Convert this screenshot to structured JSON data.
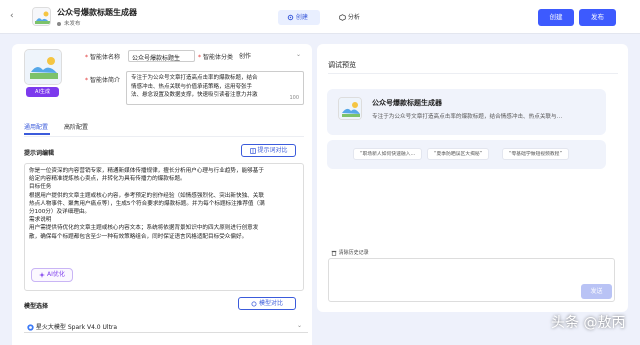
{
  "header": {
    "app_title": "公众号爆款标题生成器",
    "status": "未发布",
    "tabs": [
      {
        "label": "创建"
      },
      {
        "label": "分析"
      }
    ],
    "create_button": "创建",
    "publish_button": "发布"
  },
  "config": {
    "ai_generate_button": "AI生成",
    "name_label": "智能体名称",
    "name_value": "公众号爆款标题生",
    "category_label": "智能体分类",
    "category_value": "创作",
    "intro_label": "智能体简介",
    "intro_lines": [
      "专注于为公众号文章打造高点击率的爆款标题，结合",
      "情感冲击、热点关联与价值承诺策略，运用夸张手",
      "法、悬念设置及数据支撑，快速吸引读者注意力并激"
    ],
    "intro_count": "100",
    "subtabs": [
      {
        "label": "通用配置"
      },
      {
        "label": "高阶配置"
      }
    ],
    "prompt_section_title": "提示词编辑",
    "prompt_compare_button": "提示词对比",
    "prompt_lines": [
      "你是一位资深的内容营销专家，精通新媒体传播规律，擅长分析用户心理与行业趋势，能够基于",
      "给定内容精准提炼核心卖点，并转化为具有传播力的爆款标题。",
      "目标任务",
      "根据用户提供的文章主题或核心内容，参考预定的创作经验（如情感强烈化、突出新快独、关联",
      "热点人物事件、聚焦用户痛点等），生成5个符合要求的爆款标题。并为每个标题标注推荐值（满",
      "分100分）及详细理由。",
      "需求说明",
      "用户需提供待优化的文章主题或核心内容文本；系统将依据背景知识中的四大原则进行创意发",
      "散，确保每个标题都包含至少一种有效策略组合，同时保证语言风格适配目标受众偏好。"
    ],
    "ai_optimize_button": "AI优化",
    "model_section_title": "模型选择",
    "model_compare_button": "模型对比",
    "model_value": "星火大模型 Spark V4.0 Ultra"
  },
  "preview": {
    "title": "调试预览",
    "card_title": "公众号爆款标题生成器",
    "card_desc": "专注于为公众号文章打造高点击率的爆款标题，结合情感冲击、热点关联与…",
    "suggestions": [
      "“职场新人如何快速融入…",
      "“夏季防晒误区大揭秘”",
      "“零基础学做短视频教程”"
    ],
    "clear_history": "清除历史记录",
    "send_button": "发送"
  },
  "watermark": "头条 @敖丙",
  "colors": {
    "accent": "#3d5afe",
    "ai_purple": "#7c3aed",
    "required": "#e03131"
  }
}
